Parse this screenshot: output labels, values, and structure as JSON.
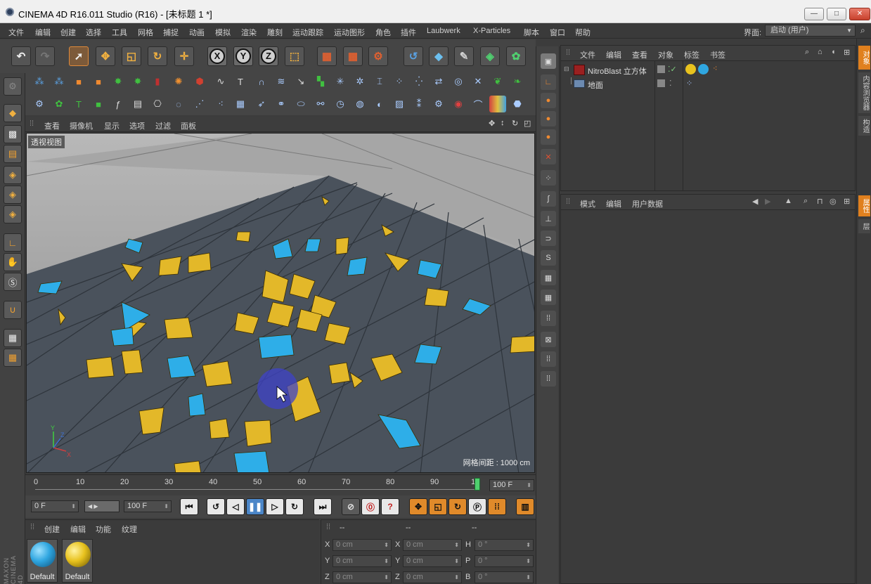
{
  "window": {
    "title": "CINEMA 4D R16.011 Studio (R16) - [未标题 1 *]",
    "minimize": "—",
    "maximize": "□",
    "close": "✕"
  },
  "menubar": {
    "items": [
      "文件",
      "编辑",
      "创建",
      "选择",
      "工具",
      "网格",
      "捕捉",
      "动画",
      "模拟",
      "渲染",
      "雕刻",
      "运动跟踪",
      "运动图形",
      "角色",
      "插件",
      "Laubwerk",
      "X-Particles",
      "脚本",
      "窗口",
      "帮助"
    ],
    "layout_label": "界面:",
    "layout_value": "启动 (用户)"
  },
  "viewport": {
    "menu": [
      "查看",
      "摄像机",
      "显示",
      "选项",
      "过滤",
      "面板"
    ],
    "label": "透视视图",
    "grid_spacing": "网格间距 : 1000 cm",
    "axis_labels": {
      "y": "Y",
      "z": "Z",
      "x": "X"
    }
  },
  "object_manager": {
    "menu": [
      "文件",
      "编辑",
      "查看",
      "对象",
      "标签",
      "书签"
    ],
    "objects": [
      {
        "name": "NitroBlast 立方体",
        "icon": "nitroblast-icon"
      },
      {
        "name": "地面",
        "icon": "floor-icon"
      }
    ]
  },
  "attribute_manager": {
    "menu": [
      "模式",
      "编辑",
      "用户数据"
    ]
  },
  "right_tabs": [
    "对象",
    "内容浏览器",
    "构造",
    "属性",
    "层"
  ],
  "timeline": {
    "ticks": [
      "0",
      "10",
      "20",
      "30",
      "40",
      "50",
      "60",
      "70",
      "80",
      "90",
      "1"
    ],
    "end_frame": "100 F",
    "playhead_frame": 100
  },
  "transport": {
    "current_frame": "0 F",
    "max_frame": "100 F"
  },
  "material_manager": {
    "menu": [
      "创建",
      "编辑",
      "功能",
      "纹理"
    ],
    "materials": [
      {
        "name": "Default",
        "color": "#2fa6e0"
      },
      {
        "name": "Default",
        "color": "#e8c21e"
      }
    ]
  },
  "coordinate_manager": {
    "headers": [
      "--",
      "--",
      "--"
    ],
    "rows": [
      {
        "a_label": "X",
        "a_value": "0 cm",
        "b_label": "X",
        "b_value": "0 cm",
        "c_label": "H",
        "c_value": "0 °"
      },
      {
        "a_label": "Y",
        "a_value": "0 cm",
        "b_label": "Y",
        "b_value": "0 cm",
        "c_label": "P",
        "c_value": "0 °"
      },
      {
        "a_label": "Z",
        "a_value": "0 cm",
        "b_label": "Z",
        "b_value": "0 cm",
        "c_label": "B",
        "c_value": "0 °"
      }
    ]
  },
  "brand": "MAXON CINEMA 4D",
  "colors": {
    "debris_gold": "#e3b829",
    "debris_cyan": "#2eaee8",
    "accent_orange": "#e0801e",
    "playhead_green": "#4fcf6e"
  }
}
